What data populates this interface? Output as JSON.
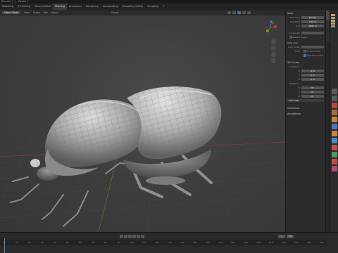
{
  "window": {
    "title": "Blender [...] - Beetle 1"
  },
  "workspaces": [
    {
      "label": "Modeling",
      "active": false
    },
    {
      "label": "UV Editing",
      "active": false
    },
    {
      "label": "Texture Paint",
      "active": false
    },
    {
      "label": "Shading",
      "active": true
    },
    {
      "label": "Animation",
      "active": false
    },
    {
      "label": "Rendering",
      "active": false
    },
    {
      "label": "Compositing",
      "active": false
    },
    {
      "label": "Geometry Nodes",
      "active": false
    },
    {
      "label": "Scripting",
      "active": false
    },
    {
      "label": "+",
      "active": false
    }
  ],
  "viewport_header": {
    "mode": "Object Mode",
    "view": "View",
    "select": "Select",
    "add": "Add",
    "object": "Object",
    "transform": "Global"
  },
  "npanel": {
    "view_section": "View",
    "focal_label": "Focal Len",
    "focal_value": "50 mm",
    "clip_start_label": "Clip Start",
    "clip_start_value": "0.01 m",
    "clip_end_label": "End",
    "clip_end_value": "1000 m",
    "local_cam_label": "Local Cam",
    "render_region": "Render Region",
    "view_lock": "View Lock",
    "lock_to_obj": "Lock to Obj",
    "lock_label": "Lock",
    "to_cursor": "To 3D Cursor",
    "camera_to_view": "Camera to View",
    "cursor_section": "3D Cursor",
    "location_label": "Location:",
    "loc_x": "0 m",
    "loc_y": "0 m",
    "loc_z": "0 m",
    "rotation_label": "Rotation:",
    "rot_x": "0°",
    "rot_y": "0°",
    "rot_z": "0°",
    "rot_mode": "XYZ Euler",
    "collections": "Collections",
    "annotations": "Annotations"
  },
  "timeline": {
    "ticks": [
      "0",
      "10",
      "20",
      "30",
      "40",
      "50",
      "60",
      "70",
      "80",
      "90",
      "100",
      "110",
      "120",
      "130",
      "140",
      "150",
      "160",
      "170",
      "180",
      "190",
      "200",
      "210",
      "220",
      "230",
      "240",
      "250"
    ],
    "start": "1",
    "end": "250"
  },
  "colors": {
    "accent": "#4a6ea8",
    "axis_x": "#c9383a",
    "axis_y": "#6b9e2a",
    "axis_z": "#3a6fc4"
  }
}
